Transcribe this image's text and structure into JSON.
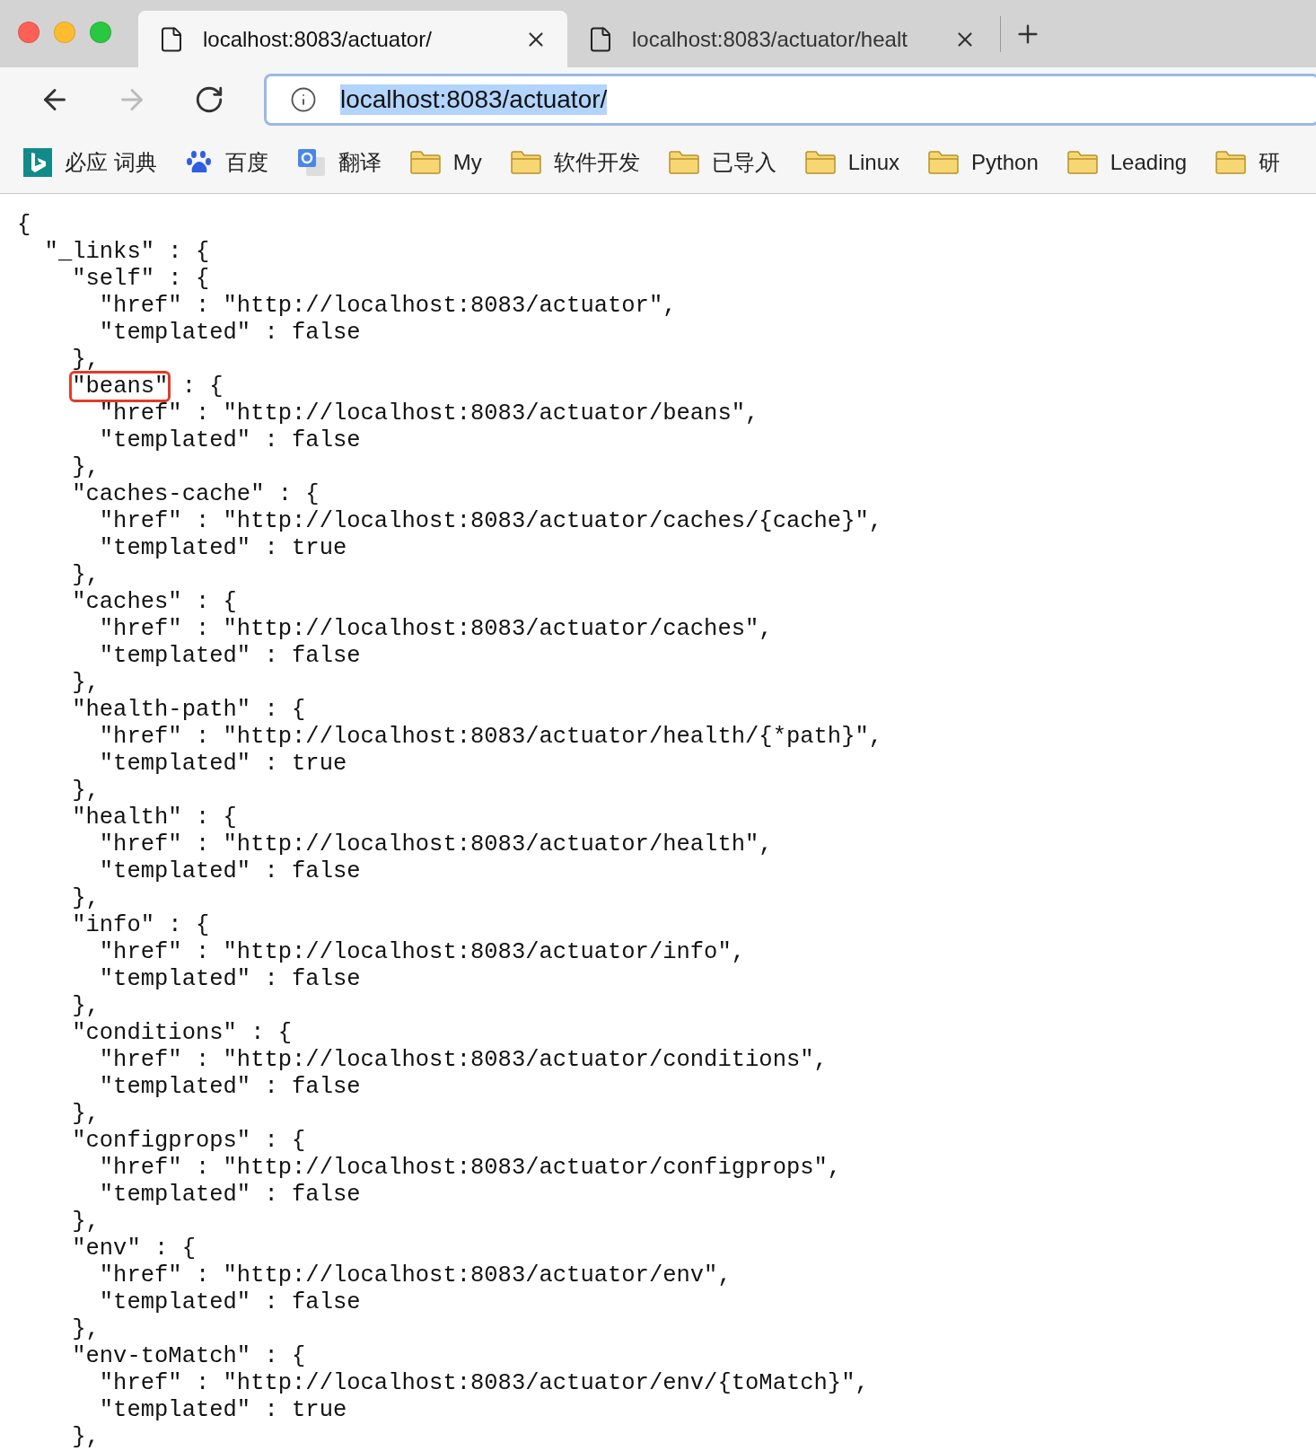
{
  "tabs": [
    {
      "title": "localhost:8083/actuator/",
      "selected": true
    },
    {
      "title": "localhost:8083/actuator/healt",
      "selected": false
    }
  ],
  "address_bar": {
    "value": "localhost:8083/actuator/",
    "selected": true
  },
  "navigation": {
    "forward_disabled": true
  },
  "bookmarks": [
    {
      "kind": "bing",
      "label": "必应 词典"
    },
    {
      "kind": "paw",
      "label": "百度"
    },
    {
      "kind": "translate",
      "label": "翻译"
    },
    {
      "kind": "folder",
      "label": "My"
    },
    {
      "kind": "folder",
      "label": "软件开发"
    },
    {
      "kind": "folder",
      "label": "已导入"
    },
    {
      "kind": "folder",
      "label": "Linux"
    },
    {
      "kind": "folder",
      "label": "Python"
    },
    {
      "kind": "folder",
      "label": "Leading"
    },
    {
      "kind": "folder",
      "label": "研"
    }
  ],
  "document": {
    "lines": [
      {
        "text": "{"
      },
      {
        "text": "  \"_links\" : {"
      },
      {
        "text": "    \"self\" : {"
      },
      {
        "text": "      \"href\" : \"http://localhost:8083/actuator\","
      },
      {
        "text": "      \"templated\" : false"
      },
      {
        "text": "    },"
      },
      {
        "text": "    \"beans\" : {",
        "boxed": true
      },
      {
        "text": "      \"href\" : \"http://localhost:8083/actuator/beans\","
      },
      {
        "text": "      \"templated\" : false"
      },
      {
        "text": "    },"
      },
      {
        "text": "    \"caches-cache\" : {"
      },
      {
        "text": "      \"href\" : \"http://localhost:8083/actuator/caches/{cache}\","
      },
      {
        "text": "      \"templated\" : true"
      },
      {
        "text": "    },"
      },
      {
        "text": "    \"caches\" : {"
      },
      {
        "text": "      \"href\" : \"http://localhost:8083/actuator/caches\","
      },
      {
        "text": "      \"templated\" : false"
      },
      {
        "text": "    },"
      },
      {
        "text": "    \"health-path\" : {"
      },
      {
        "text": "      \"href\" : \"http://localhost:8083/actuator/health/{*path}\","
      },
      {
        "text": "      \"templated\" : true"
      },
      {
        "text": "    },"
      },
      {
        "text": "    \"health\" : {"
      },
      {
        "text": "      \"href\" : \"http://localhost:8083/actuator/health\","
      },
      {
        "text": "      \"templated\" : false"
      },
      {
        "text": "    },"
      },
      {
        "text": "    \"info\" : {"
      },
      {
        "text": "      \"href\" : \"http://localhost:8083/actuator/info\","
      },
      {
        "text": "      \"templated\" : false"
      },
      {
        "text": "    },"
      },
      {
        "text": "    \"conditions\" : {"
      },
      {
        "text": "      \"href\" : \"http://localhost:8083/actuator/conditions\","
      },
      {
        "text": "      \"templated\" : false"
      },
      {
        "text": "    },"
      },
      {
        "text": "    \"configprops\" : {"
      },
      {
        "text": "      \"href\" : \"http://localhost:8083/actuator/configprops\","
      },
      {
        "text": "      \"templated\" : false"
      },
      {
        "text": "    },"
      },
      {
        "text": "    \"env\" : {"
      },
      {
        "text": "      \"href\" : \"http://localhost:8083/actuator/env\","
      },
      {
        "text": "      \"templated\" : false"
      },
      {
        "text": "    },"
      },
      {
        "text": "    \"env-toMatch\" : {"
      },
      {
        "text": "      \"href\" : \"http://localhost:8083/actuator/env/{toMatch}\","
      },
      {
        "text": "      \"templated\" : true"
      },
      {
        "text": "    },"
      }
    ]
  }
}
